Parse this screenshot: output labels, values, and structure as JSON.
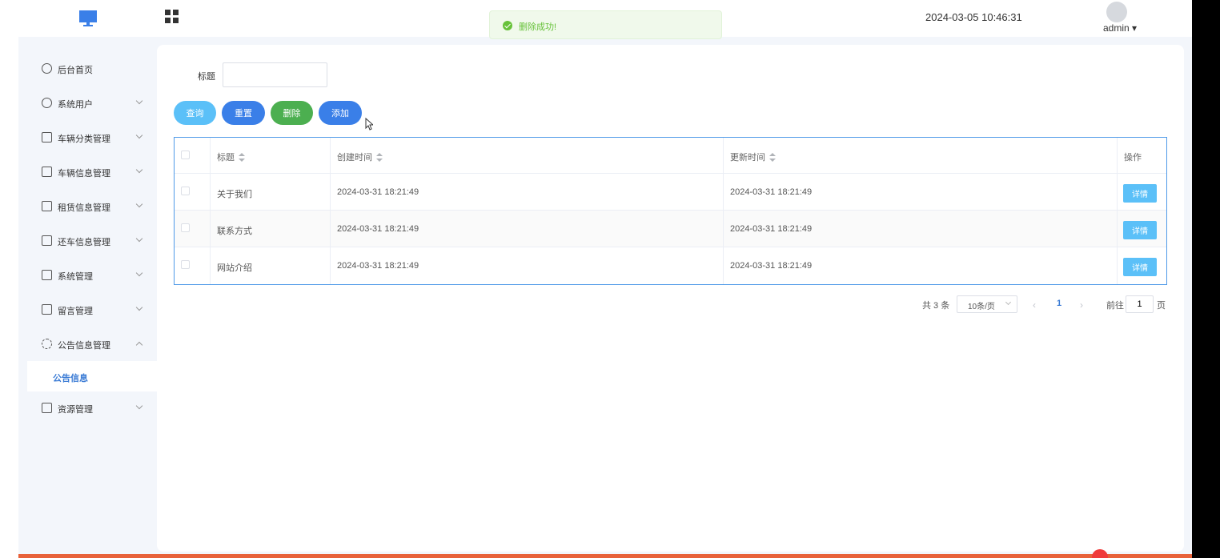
{
  "header": {
    "datetime": "2024-03-05 10:46:31",
    "user_name": "admin ▾",
    "icons": {
      "logo": "monitor-icon",
      "menu_toggle": "grid-icon",
      "avatar": "clock-avatar"
    }
  },
  "toast": {
    "message": "删除成功!",
    "icon": "success-check-icon",
    "color": "#67c23a"
  },
  "sidebar": {
    "items": [
      {
        "label": "后台首页",
        "icon": "pie-icon",
        "expanded": false
      },
      {
        "label": "系统用户",
        "icon": "user-icon",
        "expanded": false
      },
      {
        "label": "车辆分类管理",
        "icon": "folder-icon",
        "expanded": false
      },
      {
        "label": "车辆信息管理",
        "icon": "folder-icon",
        "expanded": false
      },
      {
        "label": "租赁信息管理",
        "icon": "folder-icon",
        "expanded": false
      },
      {
        "label": "还车信息管理",
        "icon": "folder-icon",
        "expanded": false
      },
      {
        "label": "系统管理",
        "icon": "check-box-icon",
        "expanded": false
      },
      {
        "label": "留言管理",
        "icon": "check-box-icon",
        "expanded": false
      },
      {
        "label": "公告信息管理",
        "icon": "loading-icon",
        "expanded": true
      },
      {
        "label": "资源管理",
        "icon": "printer-icon",
        "expanded": false
      }
    ],
    "active_sub": "公告信息"
  },
  "filter": {
    "title_label": "标题",
    "title_value": ""
  },
  "actions": {
    "query": "查询",
    "reset": "重置",
    "delete": "删除",
    "add": "添加"
  },
  "table": {
    "headers": [
      "标题",
      "创建时间",
      "更新时间",
      "操作"
    ],
    "rows": [
      {
        "title": "关于我们",
        "created": "2024-03-31 18:21:49",
        "updated": "2024-03-31 18:21:49",
        "action": "详情"
      },
      {
        "title": "联系方式",
        "created": "2024-03-31 18:21:49",
        "updated": "2024-03-31 18:21:49",
        "action": "详情"
      },
      {
        "title": "网站介绍",
        "created": "2024-03-31 18:21:49",
        "updated": "2024-03-31 18:21:49",
        "action": "详情"
      }
    ]
  },
  "pagination": {
    "total": "共 3 条",
    "page_size": "10条/页",
    "current_page": "1",
    "goto_label": "前往",
    "goto_value": "1",
    "goto_unit": "页"
  },
  "colors": {
    "accent": "#3a7fe8",
    "info": "#5bc0f8",
    "success": "#4caf50"
  }
}
